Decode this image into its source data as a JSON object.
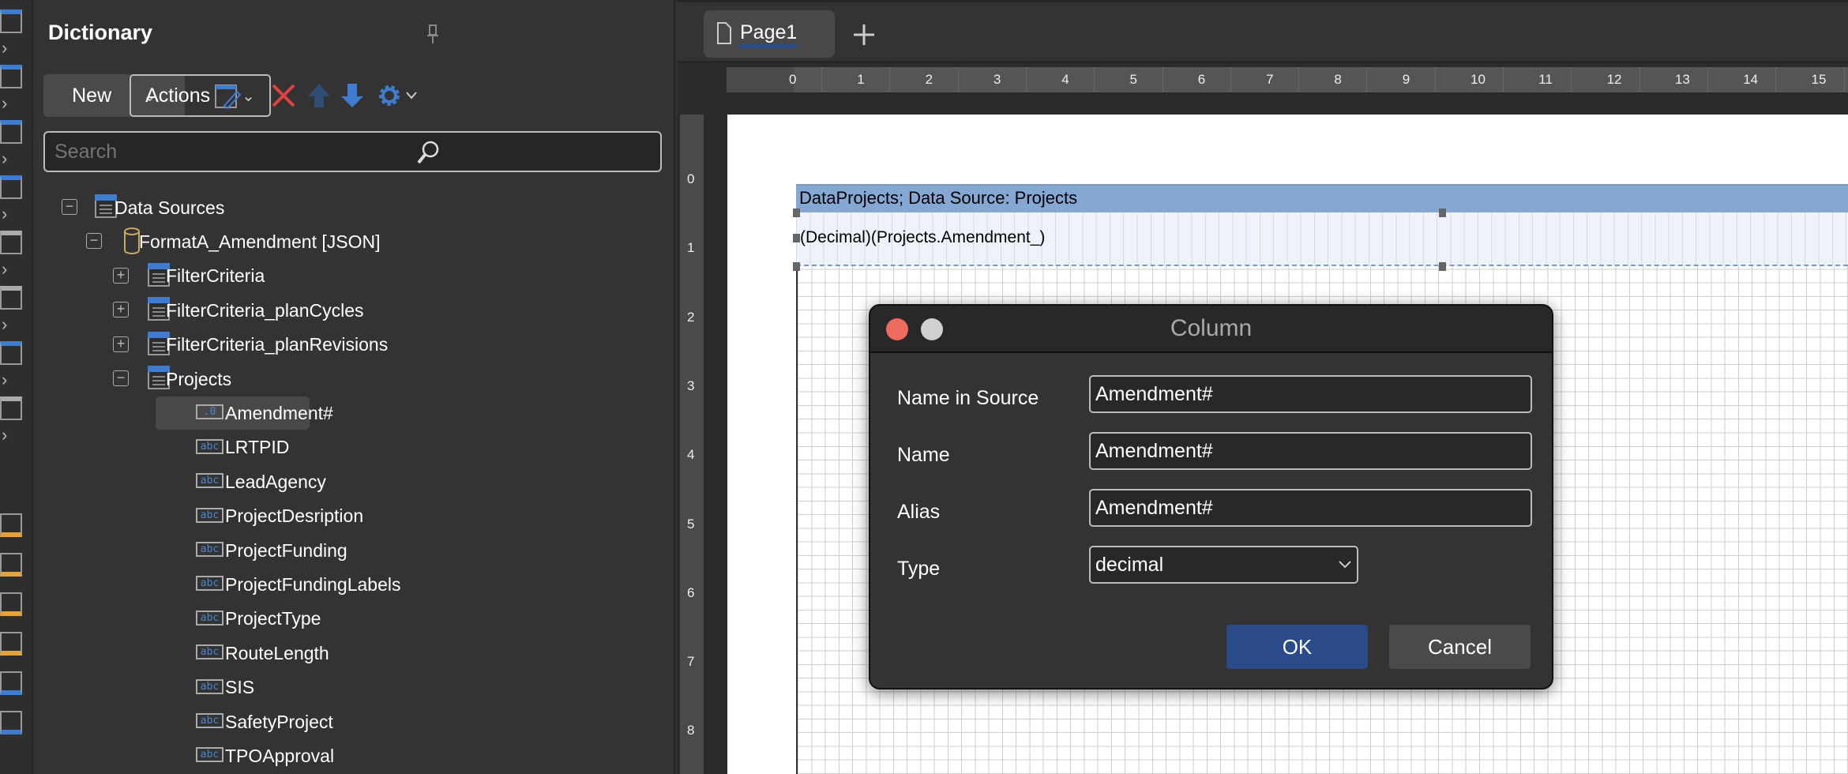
{
  "dictionary": {
    "title": "Dictionary",
    "new_label": "New",
    "actions_label": "Actions",
    "search_placeholder": "Search",
    "tree": [
      {
        "label": "Data Sources",
        "level": 0,
        "expander": "minus",
        "icon": "table"
      },
      {
        "label": "FormatA_Amendment [JSON]",
        "level": 1,
        "expander": "minus",
        "icon": "database"
      },
      {
        "label": "FilterCriteria",
        "level": 2,
        "expander": "plus",
        "icon": "table"
      },
      {
        "label": "FilterCriteria_planCycles",
        "level": 2,
        "expander": "plus",
        "icon": "table"
      },
      {
        "label": "FilterCriteria_planRevisions",
        "level": 2,
        "expander": "plus",
        "icon": "table"
      },
      {
        "label": "Projects",
        "level": 2,
        "expander": "minus",
        "icon": "table"
      },
      {
        "label": "Amendment#",
        "level": 3,
        "icon": "decimal",
        "icon_text": ".0",
        "selected": true
      },
      {
        "label": "LRTPID",
        "level": 3,
        "icon": "string",
        "icon_text": "abc"
      },
      {
        "label": "LeadAgency",
        "level": 3,
        "icon": "string",
        "icon_text": "abc"
      },
      {
        "label": "ProjectDesription",
        "level": 3,
        "icon": "string",
        "icon_text": "abc"
      },
      {
        "label": "ProjectFunding",
        "level": 3,
        "icon": "string",
        "icon_text": "abc"
      },
      {
        "label": "ProjectFundingLabels",
        "level": 3,
        "icon": "string",
        "icon_text": "abc"
      },
      {
        "label": "ProjectType",
        "level": 3,
        "icon": "string",
        "icon_text": "abc"
      },
      {
        "label": "RouteLength",
        "level": 3,
        "icon": "string",
        "icon_text": "abc"
      },
      {
        "label": "SIS",
        "level": 3,
        "icon": "string",
        "icon_text": "abc"
      },
      {
        "label": "SafetyProject",
        "level": 3,
        "icon": "string",
        "icon_text": "abc"
      },
      {
        "label": "TPOApproval",
        "level": 3,
        "icon": "string",
        "icon_text": "abc"
      }
    ]
  },
  "tabs": {
    "page1": "Page1"
  },
  "ruler": {
    "h": [
      "0",
      "1",
      "2",
      "3",
      "4",
      "5",
      "6",
      "7",
      "8",
      "9",
      "10",
      "11",
      "12",
      "13",
      "14",
      "15"
    ],
    "v": [
      "0",
      "1",
      "2",
      "3",
      "4",
      "5",
      "6",
      "7",
      "8"
    ]
  },
  "report": {
    "band_header": "DataProjects; Data Source: Projects",
    "band_text": "(Decimal)(Projects.Amendment_)"
  },
  "dialog": {
    "title": "Column",
    "name_in_source_label": "Name in Source",
    "name_in_source": "Amendment#",
    "name_label": "Name",
    "name": "Amendment#",
    "alias_label": "Alias",
    "alias": "Amendment#",
    "type_label": "Type",
    "type": "decimal",
    "ok": "OK",
    "cancel": "Cancel"
  },
  "colors": {
    "accent": "#2a4a8a",
    "band": "#84a7d4",
    "close": "#ec6a5e",
    "delete": "#e04040",
    "icon_blue": "#3f7ccf"
  }
}
